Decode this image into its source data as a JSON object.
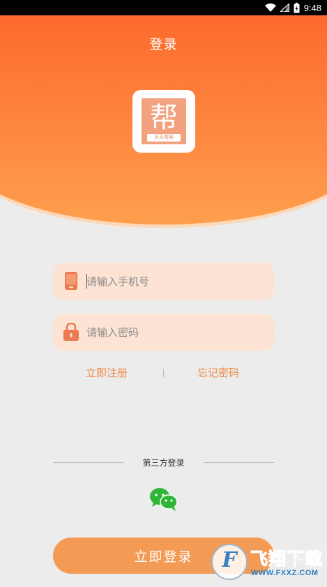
{
  "status_bar": {
    "time": "9:48"
  },
  "header": {
    "title": "登录"
  },
  "logo": {
    "char": "帮",
    "caption": "天天帮客"
  },
  "form": {
    "phone": {
      "placeholder": "请输入手机号",
      "value": ""
    },
    "password": {
      "placeholder": "请输入密码",
      "value": ""
    }
  },
  "links": {
    "register": "立即注册",
    "divider": "|",
    "forgot": "忘记密码"
  },
  "third_party": {
    "label": "第三方登录",
    "providers": [
      "wechat-icon"
    ]
  },
  "login_button": {
    "label": "立即登录"
  },
  "watermark": {
    "brand": "飞翔下载",
    "url": "WWW.FXXZ.COM"
  },
  "colors": {
    "accent": "#fd4621",
    "accent_light": "#fe9f4d",
    "field_bg": "#fce3d3",
    "link": "#ef8a46",
    "button": "#f39a55",
    "wechat": "#2fb637"
  }
}
